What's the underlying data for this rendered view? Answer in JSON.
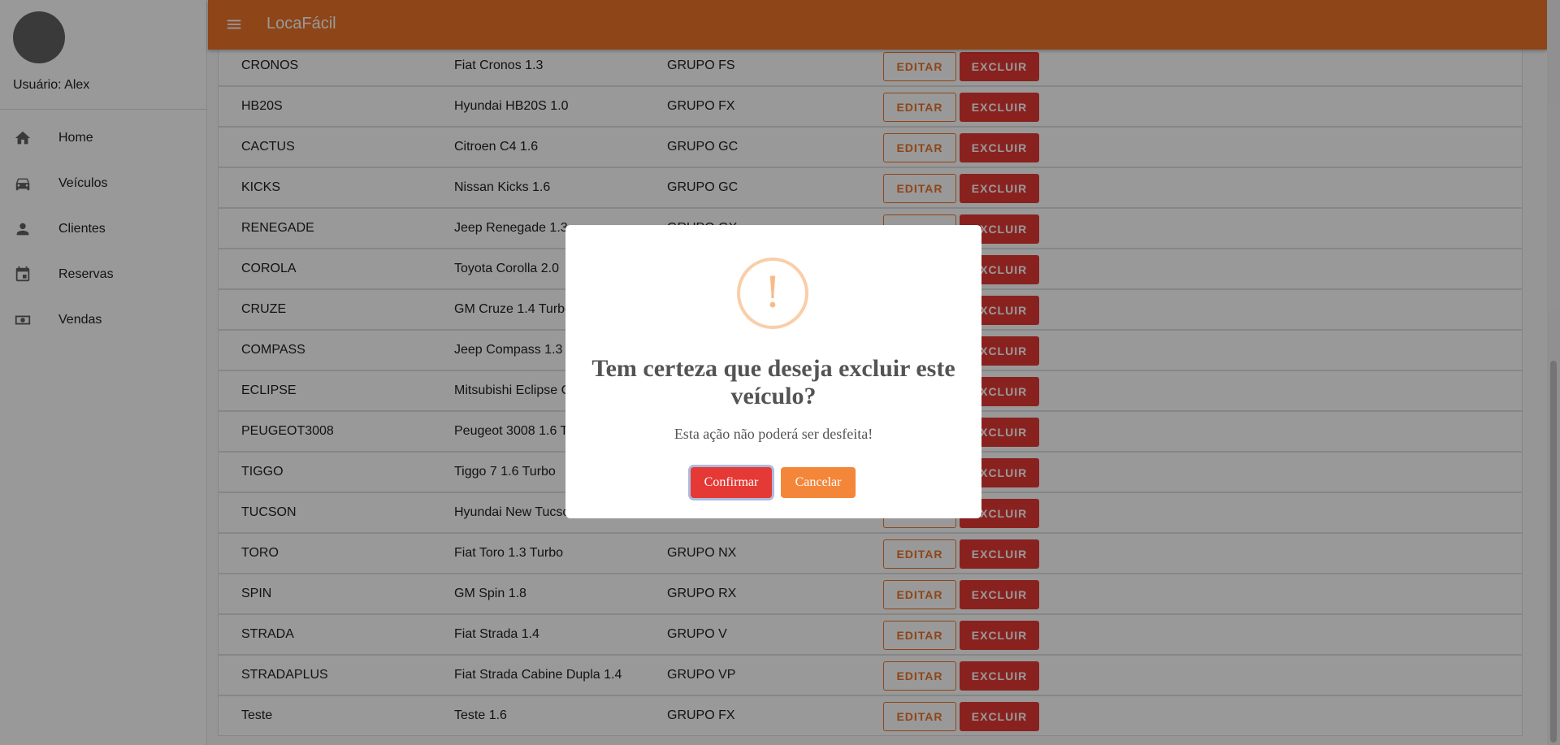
{
  "sidebar": {
    "user_label": "Usuário: Alex",
    "items": [
      {
        "label": "Home",
        "icon": "home-icon"
      },
      {
        "label": "Veículos",
        "icon": "car-icon"
      },
      {
        "label": "Clientes",
        "icon": "person-icon"
      },
      {
        "label": "Reservas",
        "icon": "calendar-icon"
      },
      {
        "label": "Vendas",
        "icon": "money-icon"
      }
    ]
  },
  "header": {
    "title": "LocaFácil",
    "menu_icon": "menu-icon"
  },
  "colors": {
    "primary": "#ed7428",
    "danger": "#e53935",
    "warning_icon": "#f8bb86"
  },
  "table": {
    "edit_label": "EDITAR",
    "delete_label": "EXCLUIR",
    "rows": [
      {
        "model": "CRONOS",
        "name": "Fiat Cronos 1.3",
        "group": "GRUPO FS"
      },
      {
        "model": "HB20S",
        "name": "Hyundai HB20S 1.0",
        "group": "GRUPO FX"
      },
      {
        "model": "CACTUS",
        "name": "Citroen C4 1.6",
        "group": "GRUPO GC"
      },
      {
        "model": "KICKS",
        "name": "Nissan Kicks 1.6",
        "group": "GRUPO GC"
      },
      {
        "model": "RENEGADE",
        "name": "Jeep Renegade 1.3",
        "group": "GRUPO GX"
      },
      {
        "model": "COROLA",
        "name": "Toyota Corolla 2.0",
        "group": ""
      },
      {
        "model": "CRUZE",
        "name": "GM Cruze 1.4 Turbo",
        "group": ""
      },
      {
        "model": "COMPASS",
        "name": "Jeep Compass 1.3",
        "group": ""
      },
      {
        "model": "ECLIPSE",
        "name": "Mitsubishi Eclipse C",
        "group": ""
      },
      {
        "model": "PEUGEOT3008",
        "name": "Peugeot 3008 1.6 T",
        "group": ""
      },
      {
        "model": "TIGGO",
        "name": "Tiggo 7 1.6 Turbo",
        "group": ""
      },
      {
        "model": "TUCSON",
        "name": "Hyundai New Tucso",
        "group": ""
      },
      {
        "model": "TORO",
        "name": "Fiat Toro 1.3 Turbo",
        "group": "GRUPO NX"
      },
      {
        "model": "SPIN",
        "name": "GM Spin 1.8",
        "group": "GRUPO RX"
      },
      {
        "model": "STRADA",
        "name": "Fiat Strada 1.4",
        "group": "GRUPO V"
      },
      {
        "model": "STRADAPLUS",
        "name": "Fiat Strada Cabine Dupla 1.4",
        "group": "GRUPO VP"
      },
      {
        "model": "Teste",
        "name": "Teste 1.6",
        "group": "GRUPO FX"
      }
    ]
  },
  "dialog": {
    "icon": "warning-icon",
    "icon_glyph": "!",
    "title": "Tem certeza que deseja excluir este veículo?",
    "text": "Esta ação não poderá ser desfeita!",
    "confirm_label": "Confirmar",
    "cancel_label": "Cancelar"
  }
}
